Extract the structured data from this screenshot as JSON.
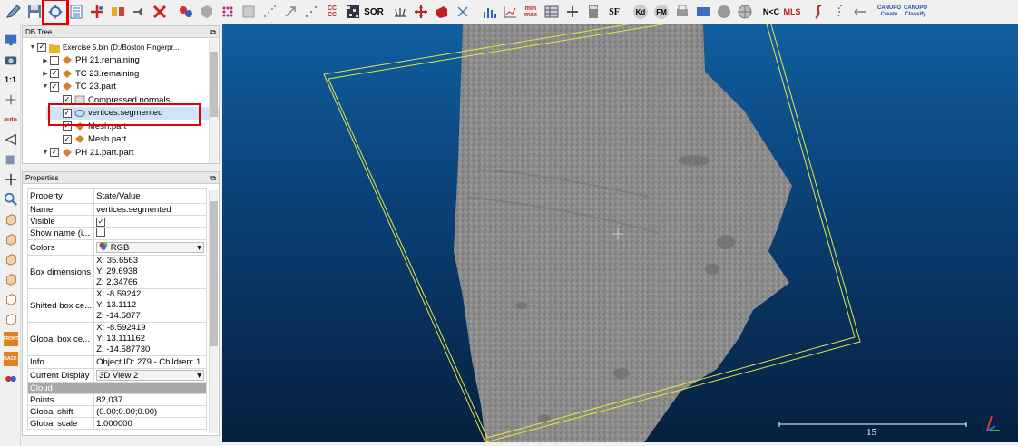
{
  "toolbar": {
    "buttons": [
      {
        "icon": "pencil-icon"
      },
      {
        "icon": "save-icon"
      },
      {
        "icon": "transform-icon"
      },
      {
        "icon": "list-icon"
      },
      {
        "icon": "segment-icon"
      },
      {
        "icon": "merge-icon"
      },
      {
        "icon": "clone-icon"
      },
      {
        "icon": "delete-icon"
      }
    ],
    "sor_label": "SOR",
    "sf_label": "SF",
    "kd_label": "Kd",
    "fm_label": "FM",
    "nc_label": "N<C",
    "mls_label": "MLS",
    "canupo_create": "CANUPO\nCreate",
    "canupo_classify": "CANUPO\nClassify",
    "cc_label": "CC CC"
  },
  "left_tools": {
    "ratio_label": "1:1",
    "auto_label": "auto",
    "front_label": "FRONT",
    "back_label": "BACK"
  },
  "db_tree": {
    "title": "DB Tree",
    "items": [
      {
        "label": "Exercise 5.bin (D:/Boston Fingerpr...",
        "level": 0,
        "expanded": true,
        "checked": true
      },
      {
        "label": "PH 21.remaining",
        "level": 1,
        "expanded": false,
        "checked": false
      },
      {
        "label": "TC 23.remaining",
        "level": 1,
        "expanded": false,
        "checked": true
      },
      {
        "label": "TC 23.part",
        "level": 1,
        "expanded": true,
        "checked": true
      },
      {
        "label": "Compressed normals",
        "level": 2,
        "checked": true
      },
      {
        "label": "vertices.segmented",
        "level": 2,
        "checked": true,
        "selected": true
      },
      {
        "label": "Mesh.part",
        "level": 2,
        "checked": true
      },
      {
        "label": "Mesh.part",
        "level": 2,
        "checked": true
      },
      {
        "label": "PH 21.part.part",
        "level": 1,
        "expanded": true,
        "checked": true
      }
    ]
  },
  "properties": {
    "title": "Properties",
    "col_property": "Property",
    "col_value": "State/Value",
    "name_label": "Name",
    "name_value": "vertices.segmented",
    "visible_label": "Visible",
    "showname_label": "Show name (i...",
    "colors_label": "Colors",
    "colors_value": "RGB",
    "boxdim_label": "Box dimensions",
    "boxdim_x": "X: 35.6563",
    "boxdim_y": "Y: 29.6938",
    "boxdim_z": "Z: 2.34766",
    "shifted_label": "Shifted box ce...",
    "shifted_x": "X: -8.59242",
    "shifted_y": "Y: 13.1112",
    "shifted_z": "Z: -14.5877",
    "global_label": "Global box ce...",
    "global_x": "X: -8.592419",
    "global_y": "Y: 13.111162",
    "global_z": "Z: -14.587730",
    "info_label": "Info",
    "info_value": "Object ID: 279 - Children: 1",
    "display_label": "Current Display",
    "display_value": "3D View 2",
    "cloud_section": "Cloud",
    "points_label": "Points",
    "points_value": "82,037",
    "gshift_label": "Global shift",
    "gshift_value": "(0.00;0.00;0.00)",
    "gscale_label": "Global scale",
    "gscale_value": "1.000000"
  },
  "viewport": {
    "scale_label": "15",
    "colors": {
      "top": "#105fa0",
      "bottom": "#06203f",
      "bbox": "#e6e642",
      "cloud": "#8a8a8a"
    }
  }
}
